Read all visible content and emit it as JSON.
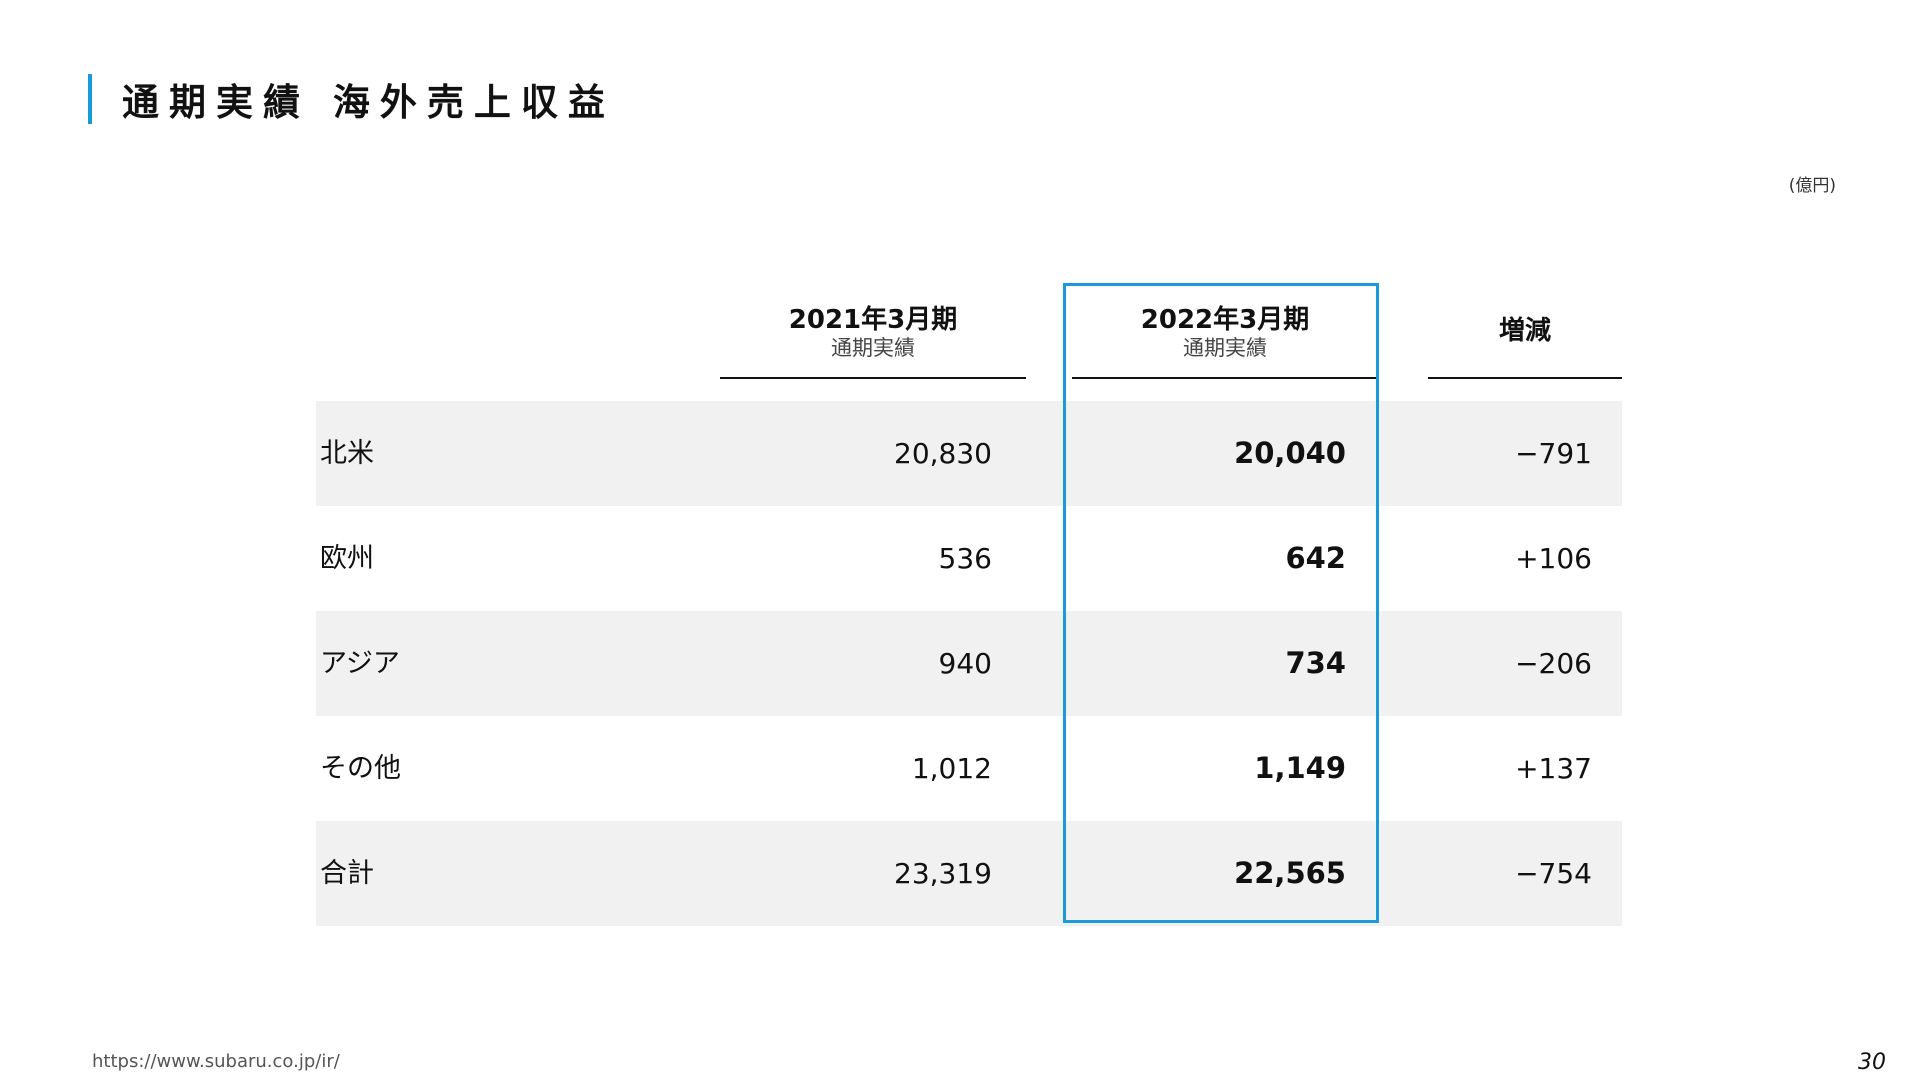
{
  "page": {
    "title": "通期実績 海外売上収益",
    "unit": "(億円)",
    "footer_url": "https://www.subaru.co.jp/ir/",
    "page_number": "30",
    "accent_color": "#1a9bd7"
  },
  "table": {
    "columns": [
      {
        "year": "2021年3月期",
        "sub": "通期実績"
      },
      {
        "year": "2022年3月期",
        "sub": "通期実績"
      },
      {
        "year": "増減",
        "sub": ""
      }
    ],
    "rows": [
      {
        "label": "北米",
        "fy2021": "20,830",
        "fy2022": "20,040",
        "diff": "−791"
      },
      {
        "label": "欧州",
        "fy2021": "536",
        "fy2022": "642",
        "diff": "+106"
      },
      {
        "label": "アジア",
        "fy2021": "940",
        "fy2022": "734",
        "diff": "−206"
      },
      {
        "label": "その他",
        "fy2021": "1,012",
        "fy2022": "1,149",
        "diff": "+137"
      },
      {
        "label": "合計",
        "fy2021": "23,319",
        "fy2022": "22,565",
        "diff": "−754"
      }
    ]
  }
}
